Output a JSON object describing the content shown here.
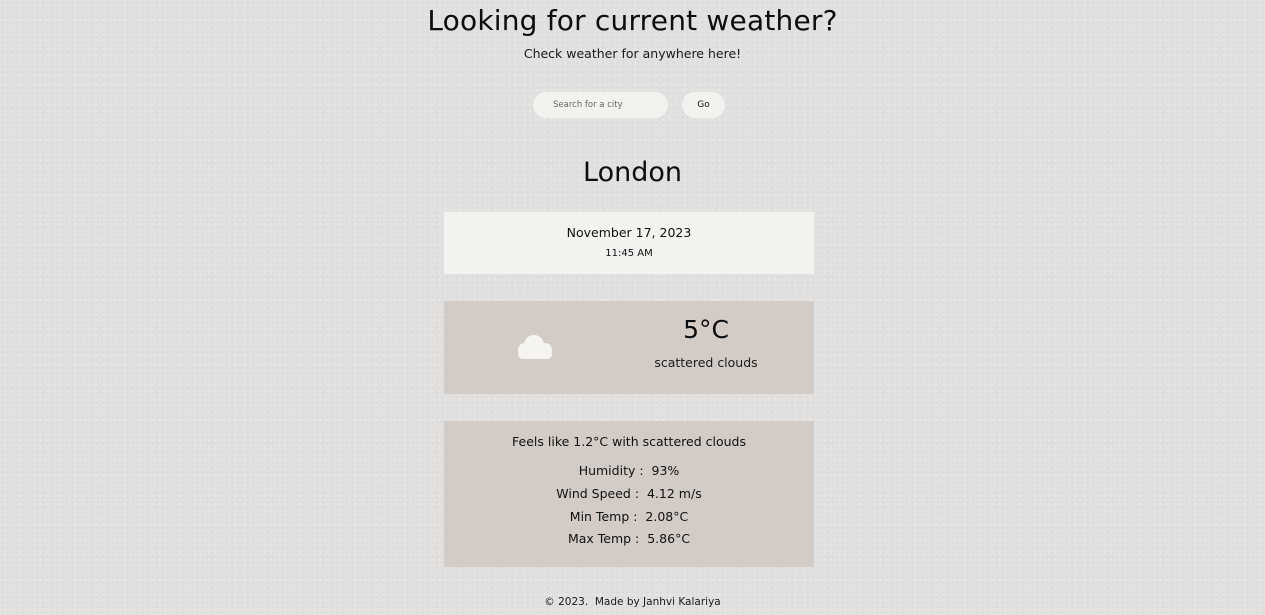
{
  "header": {
    "title": "Looking for current weather?",
    "subtitle": "Check weather for anywhere here!"
  },
  "search": {
    "placeholder": "Search for a city",
    "value": "",
    "button_label": "Go"
  },
  "city": "London",
  "datetime": {
    "date": "November 17, 2023",
    "time": "11:45 AM"
  },
  "current": {
    "icon": "cloud-icon",
    "temperature": "5°C",
    "description": "scattered clouds"
  },
  "details": {
    "feels_like": "Feels like 1.2°C with scattered clouds",
    "rows": [
      {
        "label": "Humidity :",
        "value": "93%"
      },
      {
        "label": "Wind Speed :",
        "value": "4.12 m/s"
      },
      {
        "label": "Min Temp :",
        "value": "2.08°C"
      },
      {
        "label": "Max Temp :",
        "value": "5.86°C"
      }
    ]
  },
  "footer": {
    "copyright": "© 2023.",
    "credit": "Made by Janhvi Kalariya"
  },
  "colors": {
    "background": "#e3e1df",
    "card_light": "#f4f2ef",
    "card_dark": "#d3cbc5",
    "icon": "#f6f4f1"
  }
}
